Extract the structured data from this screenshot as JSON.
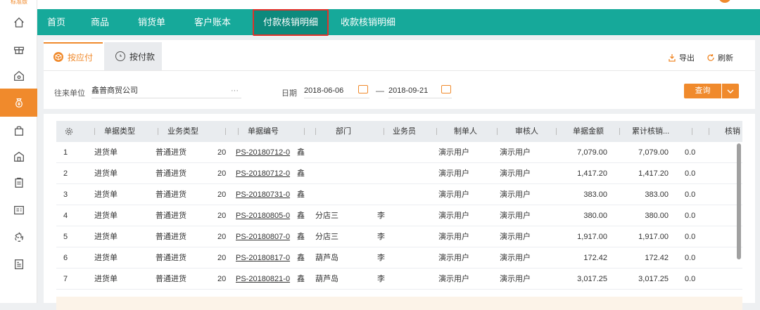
{
  "brand": {
    "badge": "标准版",
    "accent": "#f08a2c",
    "nav_bg": "#16a99a"
  },
  "sidebar": {
    "icons": [
      "home-icon",
      "gift-icon",
      "settings-home-icon",
      "money-bag-icon",
      "shopping-bag-icon",
      "store-icon",
      "clipboard-icon",
      "contacts-card-icon",
      "recycle-icon",
      "report-icon"
    ],
    "active_index": 3
  },
  "nav": {
    "items": [
      "首页",
      "商品",
      "销货单",
      "客户账本",
      "付款核销明细",
      "收款核销明细"
    ],
    "active_index": 4
  },
  "tabs": [
    {
      "label": "按应付",
      "icon": "cube-icon"
    },
    {
      "label": "按付款",
      "icon": "clock-icon"
    }
  ],
  "toolbar": {
    "export_label": "导出",
    "refresh_label": "刷新"
  },
  "filters": {
    "partner_label": "往来单位",
    "partner_value": "鑫普商贸公司",
    "partner_more": "···",
    "date_label": "日期",
    "date_from": "2018-06-06",
    "date_sep": "—",
    "date_to": "2018-09-21",
    "query_label": "查询"
  },
  "table": {
    "headers": [
      "单据类型",
      "业务类型",
      "",
      "单据编号",
      "",
      "部门",
      "业务员",
      "制单人",
      "审核人",
      "单据金额",
      "累计核销...",
      "",
      "核销"
    ],
    "rows": [
      {
        "idx": "1",
        "type": "进货单",
        "biz": "普通进货",
        "d": "20",
        "no": "PS-20180712-0",
        "p": "鑫",
        "dept": "",
        "staff": "",
        "maker": "演示用户",
        "auditor": "演示用户",
        "amount": "7,079.00",
        "writeoff": "7,079.00",
        "rest": "0.0"
      },
      {
        "idx": "2",
        "type": "进货单",
        "biz": "普通进货",
        "d": "20",
        "no": "PS-20180712-0",
        "p": "鑫",
        "dept": "",
        "staff": "",
        "maker": "演示用户",
        "auditor": "演示用户",
        "amount": "1,417.20",
        "writeoff": "1,417.20",
        "rest": "0.0"
      },
      {
        "idx": "3",
        "type": "进货单",
        "biz": "普通进货",
        "d": "20",
        "no": "PS-20180731-0",
        "p": "鑫",
        "dept": "",
        "staff": "",
        "maker": "演示用户",
        "auditor": "演示用户",
        "amount": "383.00",
        "writeoff": "383.00",
        "rest": "0.0"
      },
      {
        "idx": "4",
        "type": "进货单",
        "biz": "普通进货",
        "d": "20",
        "no": "PS-20180805-0",
        "p": "鑫",
        "dept": "分店三",
        "staff": "李",
        "maker": "演示用户",
        "auditor": "演示用户",
        "amount": "380.00",
        "writeoff": "380.00",
        "rest": "0.0"
      },
      {
        "idx": "5",
        "type": "进货单",
        "biz": "普通进货",
        "d": "20",
        "no": "PS-20180807-0",
        "p": "鑫",
        "dept": "分店三",
        "staff": "李",
        "maker": "演示用户",
        "auditor": "演示用户",
        "amount": "1,917.00",
        "writeoff": "1,917.00",
        "rest": "0.0"
      },
      {
        "idx": "6",
        "type": "进货单",
        "biz": "普通进货",
        "d": "20",
        "no": "PS-20180817-0",
        "p": "鑫",
        "dept": "葫芦岛",
        "staff": "李",
        "maker": "演示用户",
        "auditor": "演示用户",
        "amount": "172.42",
        "writeoff": "172.42",
        "rest": "0.0"
      },
      {
        "idx": "7",
        "type": "进货单",
        "biz": "普通进货",
        "d": "20",
        "no": "PS-20180821-0",
        "p": "鑫",
        "dept": "葫芦岛",
        "staff": "李",
        "maker": "演示用户",
        "auditor": "演示用户",
        "amount": "3,017.25",
        "writeoff": "3,017.25",
        "rest": "0.0"
      }
    ]
  }
}
